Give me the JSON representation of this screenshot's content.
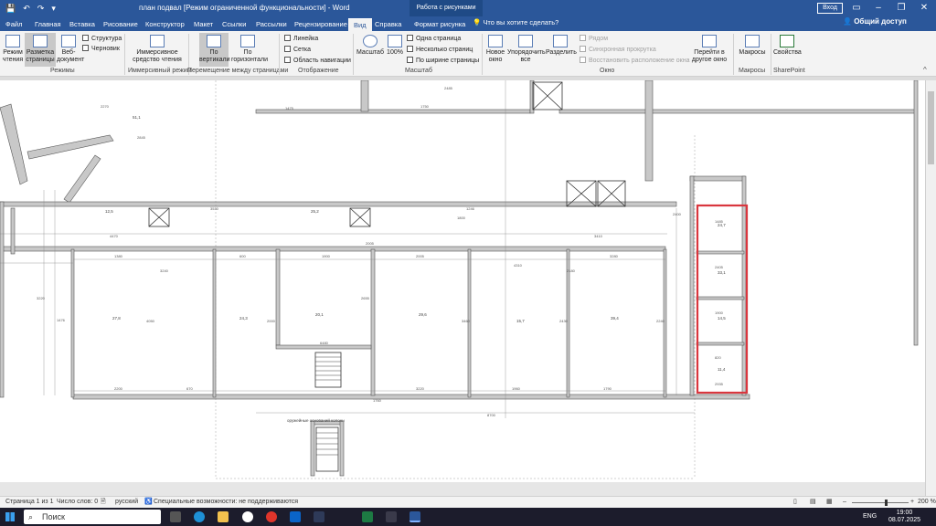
{
  "titlebar": {
    "doc_title": "план подвал [Режим ограниченной функциональности] - Word",
    "context_tools": "Работа с рисунками",
    "signin": "Вход"
  },
  "tabs": [
    "Файл",
    "Главная",
    "Вставка",
    "Рисование",
    "Конструктор",
    "Макет",
    "Ссылки",
    "Рассылки",
    "Рецензирование",
    "Вид",
    "Справка",
    "Формат рисунка"
  ],
  "tellme": "Что вы хотите сделать?",
  "share": "Общий доступ",
  "ribbon": {
    "read_mode": "Режим чтения",
    "print_layout": "Разметка страницы",
    "web_layout": "Веб-документ",
    "outline": "Структура",
    "draft": "Черновик",
    "views_group": "Режимы",
    "immersive_reader": "Иммерсивное средство чтения",
    "immersive_group": "Иммерсивный режим",
    "vertical": "По вертикали",
    "side_to_side": "По горизонтали",
    "page_movement_group": "Перемещение между страницами",
    "ruler": "Линейка",
    "gridlines": "Сетка",
    "nav_pane": "Область навигации",
    "show_group": "Отображение",
    "zoom": "Масштаб",
    "zoom_100": "100%",
    "one_page": "Одна страница",
    "multiple_pages": "Несколько страниц",
    "page_width": "По ширине страницы",
    "zoom_group": "Масштаб",
    "new_window": "Новое окно",
    "arrange_all": "Упорядочить все",
    "split": "Разделить",
    "side_by_side": "Рядом",
    "sync_scroll": "Синхронная прокрутка",
    "reset_position": "Восстановить расположение окна",
    "switch_windows": "Перейти в другое окно",
    "window_group": "Окно",
    "macros": "Макросы",
    "macros_group": "Макросы",
    "properties": "Свойства",
    "sharepoint_group": "SharePoint"
  },
  "drawing": {
    "dims": [
      "2485",
      "1475",
      "1750",
      "2845",
      "2270",
      "3530",
      "1246",
      "2005",
      "1380",
      "1900",
      "2005",
      "3280",
      "4310",
      "6480",
      "600",
      "2200",
      "670",
      "3220",
      "1960",
      "1790",
      "1760",
      "1485",
      "2405",
      "1900",
      "820",
      "2935",
      "3220",
      "1476",
      "4050",
      "2000",
      "2655",
      "3460",
      "2430",
      "2240",
      "3240",
      "2180",
      "1800",
      "4470",
      "3410",
      "2400",
      "8700"
    ],
    "rooms": [
      "12,5",
      "25,2",
      "27,8",
      "24,3",
      "20,1",
      "29,6",
      "15,7",
      "39,4",
      "24,7",
      "33,1",
      "14,5",
      "11,4",
      "51,1"
    ],
    "caption": "оружейные оснований колонн"
  },
  "statusbar": {
    "page": "Страница 1 из 1",
    "words": "Число слов: 0",
    "language": "русский",
    "accessibility": "Специальные возможности: не поддерживаются",
    "zoom": "200 %"
  },
  "taskbar": {
    "search": "Поиск",
    "time": "19:00",
    "date": "08.07.2025",
    "lang": "ENG"
  },
  "colors": {
    "word_blue": "#2b579a",
    "highlight_red": "#d9363e",
    "wall_gray": "#bfbfbf"
  }
}
